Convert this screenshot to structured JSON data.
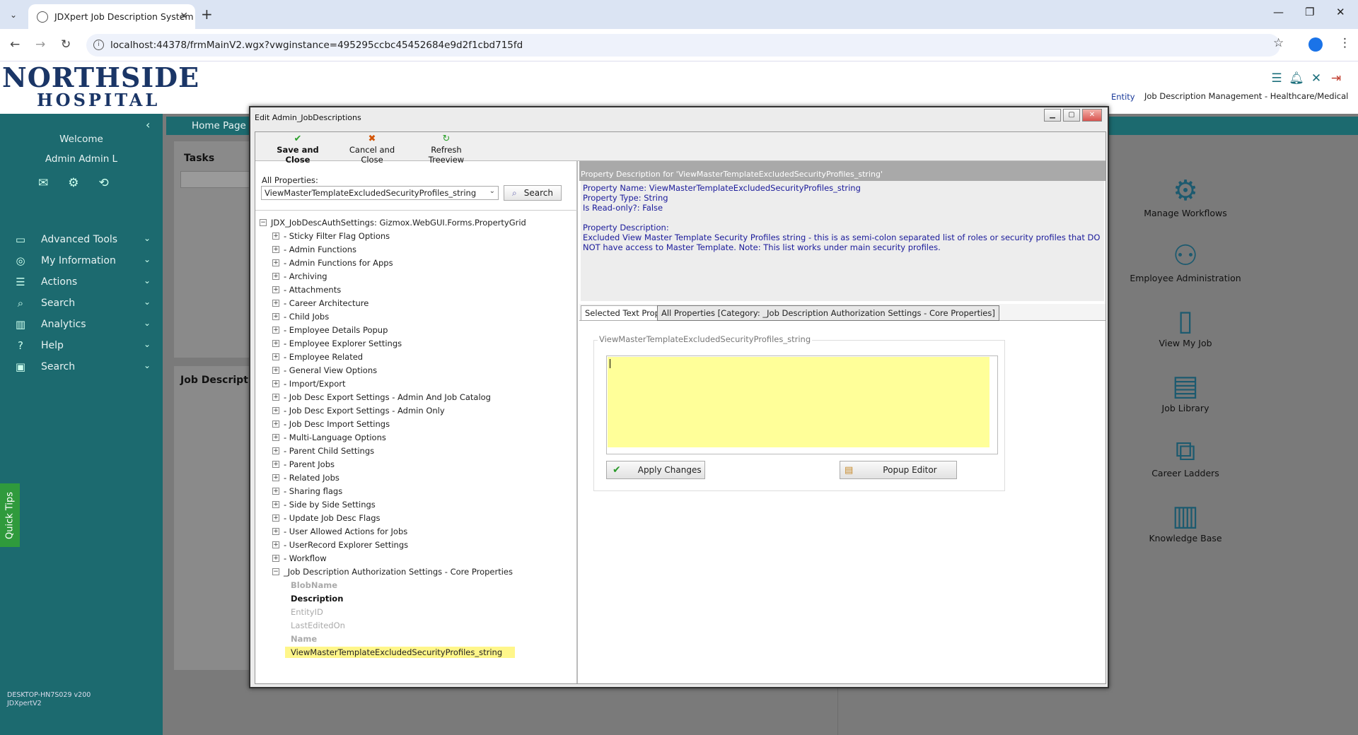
{
  "browser": {
    "tab_title": "JDXpert Job Description System",
    "url": "localhost:44378/frmMainV2.wgx?vwginstance=495295ccbc45452684e9d2f1cbd715fd"
  },
  "header": {
    "logo_top": "NORTHSIDE",
    "logo_bottom": "HOSPITAL",
    "entity_label": "Entity",
    "system_title": "Job Description Management - Healthcare/Medical"
  },
  "sidebar": {
    "welcome": "Welcome",
    "user": "Admin Admin L",
    "menu": [
      {
        "label": "Advanced Tools",
        "icon": "toolbox-icon"
      },
      {
        "label": "My Information",
        "icon": "user-circle-icon"
      },
      {
        "label": "Actions",
        "icon": "checklist-icon"
      },
      {
        "label": "Search",
        "icon": "search-icon"
      },
      {
        "label": "Analytics",
        "icon": "analytics-icon"
      },
      {
        "label": "Help",
        "icon": "help-icon"
      },
      {
        "label": "Search",
        "icon": "search-person-icon"
      }
    ],
    "version_line1": "DESKTOP-HN7S029 v200",
    "version_line2": "JDXpertV2",
    "quick_tips": "Quick Tips"
  },
  "main": {
    "home_tab": "Home Page",
    "tasks_title": "Tasks",
    "job_desc_title": "Job Descripti",
    "quick_links": [
      {
        "label": "Manage Workflows",
        "icon": "workflow-gear-icon"
      },
      {
        "label": "Employee Administration",
        "icon": "people-group-icon"
      },
      {
        "label": "View My Job",
        "icon": "document-person-icon"
      },
      {
        "label": "Job Library",
        "icon": "library-icon"
      },
      {
        "label": "Career Ladders",
        "icon": "hierarchy-icon"
      },
      {
        "label": "Knowledge Base",
        "icon": "books-icon"
      }
    ]
  },
  "dialog": {
    "title": "Edit Admin_JobDescriptions",
    "toolbar": {
      "save": "Save and Close",
      "cancel": "Cancel and Close",
      "refresh": "Refresh Treeview"
    },
    "all_properties_label": "All Properties:",
    "all_properties_value": "ViewMasterTemplateExcludedSecurityProfiles_string",
    "search_button": "Search",
    "tree": {
      "root": "JDX_JobDescAuthSettings: Gizmox.WebGUI.Forms.PropertyGrid",
      "categories": [
        " - Sticky Filter Flag Options",
        "- Admin Functions",
        "- Admin Functions for Apps",
        "- Archiving",
        "- Attachments",
        "- Career Architecture",
        "- Child Jobs",
        "- Employee Details Popup",
        "- Employee Explorer Settings",
        "- Employee Related",
        "- General View Options",
        "- Import/Export",
        "- Job Desc Export Settings - Admin And Job Catalog",
        "- Job Desc Export Settings - Admin Only",
        "- Job Desc Import Settings",
        "- Multi-Language Options",
        "- Parent Child Settings",
        "- Parent Jobs",
        "- Related Jobs",
        "- Sharing flags",
        "- Side by Side Settings",
        "- Update Job Desc Flags",
        "- User Allowed Actions for Jobs",
        "- UserRecord Explorer Settings",
        "- Workflow"
      ],
      "expanded": "_Job Description Authorization Settings - Core Properties",
      "leaves": [
        {
          "label": "BlobName",
          "style": "gray"
        },
        {
          "label": "Description",
          "style": "bold"
        },
        {
          "label": "EntityID",
          "style": "gray-normal"
        },
        {
          "label": "LastEditedOn",
          "style": "gray-normal"
        },
        {
          "label": "Name",
          "style": "gray"
        },
        {
          "label": "ViewMasterTemplateExcludedSecurityProfiles_string",
          "style": "selected"
        }
      ]
    },
    "description": {
      "header": "Property Description for 'ViewMasterTemplateExcludedSecurityProfiles_string'",
      "name_line": "Property Name: ViewMasterTemplateExcludedSecurityProfiles_string",
      "type_line": "Property Type: String",
      "readonly_line": "Is Read-only?: False",
      "desc_label": "Property Description:",
      "desc_text": "Excluded View Master Template Security Profiles string - this is as semi-colon separated list of roles or security profiles that DO NOT have access to Master Template. Note: This list works under main security profiles."
    },
    "tabs": {
      "selected": "Selected Text Property",
      "all": "All Properties [Category: _Job Description Authorization Settings - Core Properties]"
    },
    "editor": {
      "group_label": "ViewMasterTemplateExcludedSecurityProfiles_string",
      "value": "",
      "apply": "Apply Changes",
      "popup": "Popup Editor"
    }
  }
}
